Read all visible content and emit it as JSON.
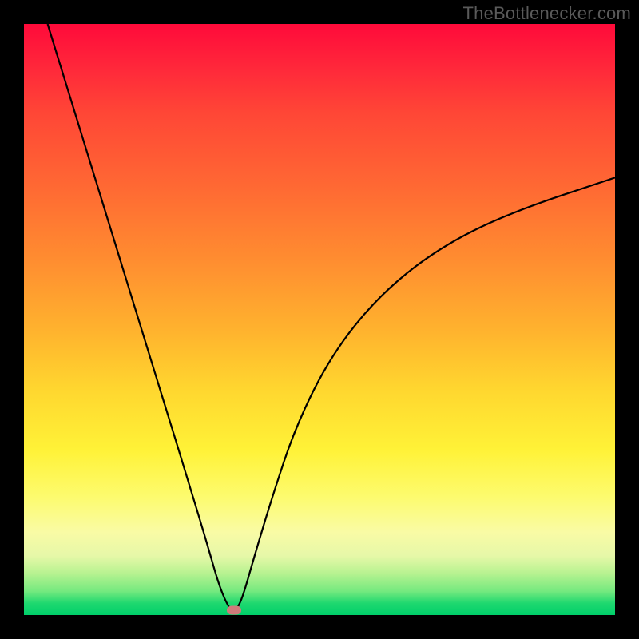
{
  "attribution": "TheBottlenecker.com",
  "chart_data": {
    "type": "line",
    "title": "",
    "xlabel": "",
    "ylabel": "",
    "xlim": [
      0,
      100
    ],
    "ylim": [
      0,
      100
    ],
    "series": [
      {
        "name": "bottleneck-curve",
        "x": [
          4,
          8,
          12,
          16,
          20,
          24,
          28,
          31,
          33,
          34.5,
          35.5,
          36,
          37,
          39,
          42,
          46,
          52,
          60,
          70,
          82,
          100
        ],
        "y": [
          100,
          87,
          74,
          61,
          48,
          35,
          22,
          12,
          5,
          1.5,
          0.5,
          1,
          3,
          10,
          20,
          32,
          44,
          54,
          62,
          68,
          74
        ]
      }
    ],
    "marker": {
      "x": 35.5,
      "y": 0.8
    },
    "background_gradient_stops": [
      {
        "pos": 0,
        "color": "#ff0a3a"
      },
      {
        "pos": 50,
        "color": "#ffb32e"
      },
      {
        "pos": 75,
        "color": "#fff237"
      },
      {
        "pos": 100,
        "color": "#00cf6a"
      }
    ]
  }
}
